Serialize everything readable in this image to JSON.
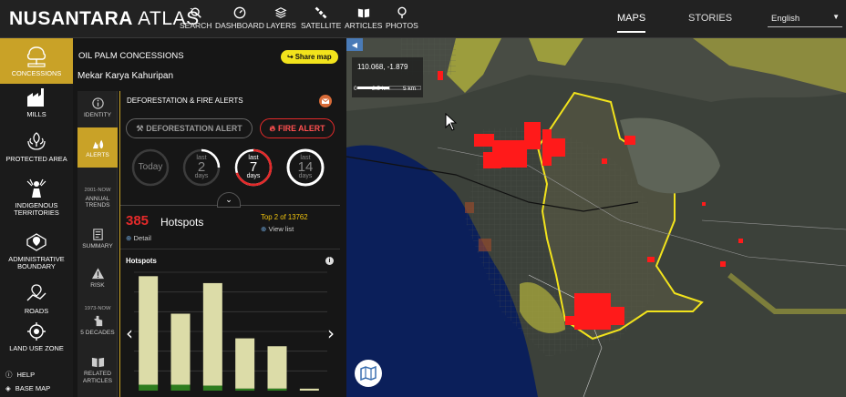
{
  "header": {
    "logo_bold": "NUSANTARA",
    "logo_light": " ATLAS",
    "nav": [
      {
        "label": "SEARCH",
        "icon": "search-icon"
      },
      {
        "label": "DASHBOARD",
        "icon": "dashboard-icon"
      },
      {
        "label": "LAYERS",
        "icon": "layers-icon"
      },
      {
        "label": "SATELLITE",
        "icon": "satellite-icon"
      },
      {
        "label": "ARTICLES",
        "icon": "articles-icon"
      },
      {
        "label": "PHOTOS",
        "icon": "photos-icon"
      }
    ],
    "maps": "MAPS",
    "stories": "STORIES",
    "language": "English"
  },
  "leftnav": {
    "items": [
      {
        "label": "CONCESSIONS",
        "icon": "concessions-icon",
        "active": true
      },
      {
        "label": "MILLS",
        "icon": "mill-icon"
      },
      {
        "label": "PROTECTED AREA",
        "icon": "protected-area-icon"
      },
      {
        "label": "INDIGENOUS TERRITORIES",
        "icon": "indigenous-icon"
      },
      {
        "label": "ADMINISTRATIVE BOUNDARY",
        "icon": "boundary-icon"
      },
      {
        "label": "ROADS",
        "icon": "roads-icon"
      },
      {
        "label": "LAND USE ZONE",
        "icon": "land-use-icon"
      }
    ],
    "help": "HELP",
    "basemap": "BASE MAP"
  },
  "panel": {
    "title": "OIL PALM CONCESSIONS",
    "subtitle": "Mekar Karya Kahuripan",
    "share": "Share map",
    "subnav": [
      {
        "label": "IDENTITY",
        "icon": "info-icon"
      },
      {
        "label": "ALERTS",
        "icon": "alerts-icon",
        "active": true
      },
      {
        "pre": "2001-NOW",
        "label": "ANNUAL TRENDS",
        "icon": ""
      },
      {
        "label": "SUMMARY",
        "icon": "summary-icon"
      },
      {
        "label": "RISK",
        "icon": "risk-icon"
      },
      {
        "pre": "1973-NOW",
        "label": "5 DECADES",
        "icon": "decades-icon"
      },
      {
        "label": "RELATED ARTICLES",
        "icon": "articles-icon"
      }
    ],
    "content": {
      "title": "DEFORESTATION & FIRE ALERTS",
      "deforestation_btn": "DEFORESTATION ALERT",
      "fire_btn": "FIRE ALERT",
      "periods": [
        {
          "label": "Today",
          "prefix": "",
          "number": "",
          "suffix": "",
          "fill": 0.0
        },
        {
          "label": "",
          "prefix": "last",
          "number": "2",
          "suffix": "days",
          "fill": 0.25
        },
        {
          "label": "",
          "prefix": "last",
          "number": "7",
          "suffix": "days",
          "fill": 0.7
        },
        {
          "label": "",
          "prefix": "last",
          "number": "14",
          "suffix": "days",
          "fill": 1.0
        }
      ],
      "hotspot_count": "385",
      "hotspot_label": "Hotspots",
      "detail": "Detail",
      "rank": "Top 2 of 13762",
      "view_list": "View list",
      "chart_label": "Hotspots"
    }
  },
  "chart_data": {
    "type": "bar",
    "categories": [
      "",
      "",
      "",
      "",
      "",
      ""
    ],
    "series": [
      {
        "values": [
          110,
          72,
          104,
          51,
          43,
          2
        ],
        "color": "#dcdca8"
      },
      {
        "values": [
          6,
          6,
          5,
          2,
          2,
          0
        ],
        "color": "#2e7d1f"
      }
    ],
    "ylim": [
      0,
      120
    ],
    "grid": true
  },
  "map": {
    "coordinate": "110.068, -1.879",
    "scale_labels": [
      "0",
      "2.5 km",
      "5 km"
    ]
  },
  "colors": {
    "accent": "#c9a227",
    "fire": "#e42a2a",
    "share": "#f2e31c"
  }
}
